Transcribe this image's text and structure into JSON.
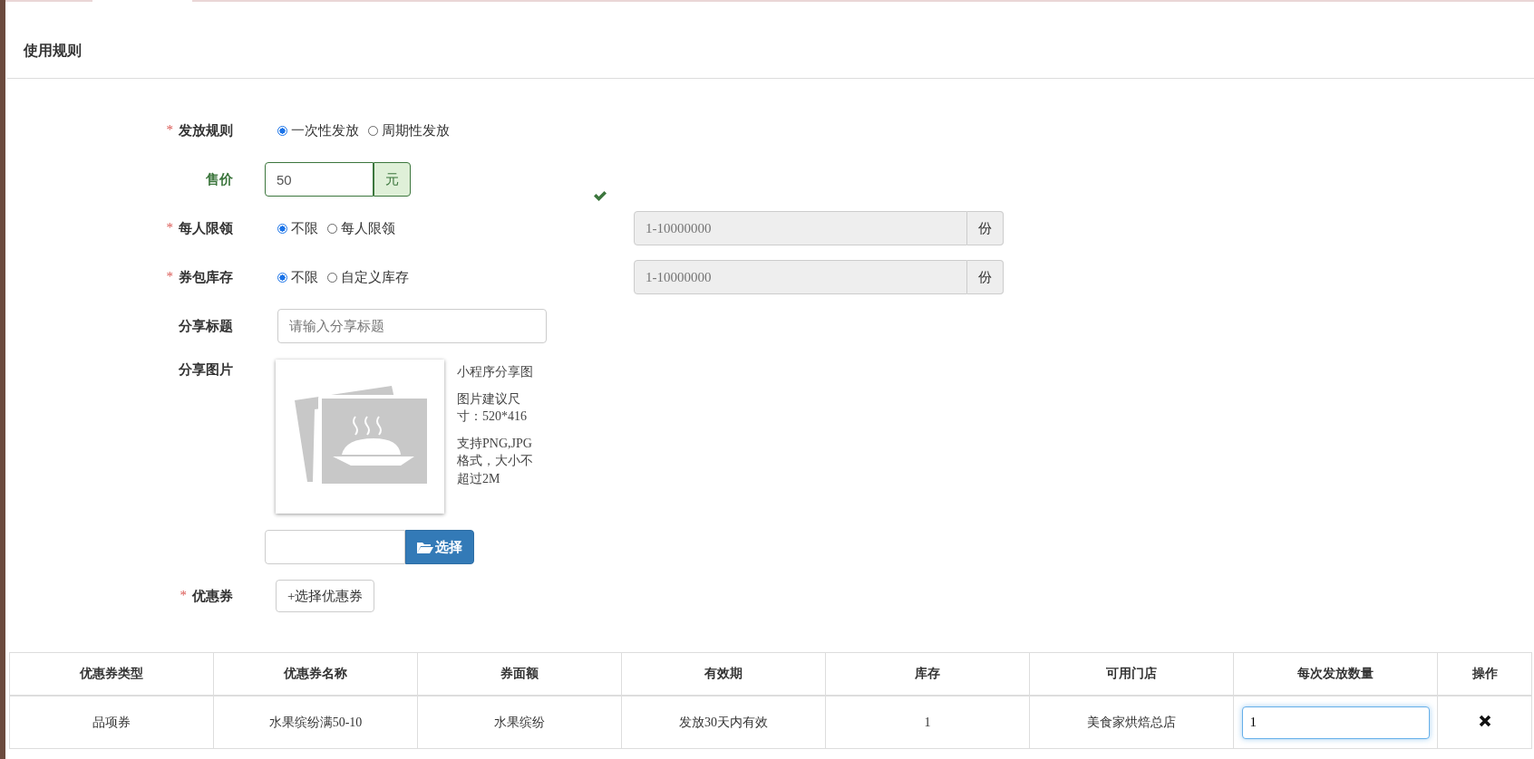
{
  "section": {
    "title": "使用规则"
  },
  "form": {
    "issue_rule": {
      "label": "发放规则",
      "required_mark": "*",
      "options": [
        {
          "label": "一次性发放",
          "selected": true
        },
        {
          "label": "周期性发放",
          "selected": false
        }
      ]
    },
    "price": {
      "label": "售价",
      "value": "50",
      "unit": "元",
      "valid": true
    },
    "per_person_limit": {
      "label": "每人限领",
      "required_mark": "*",
      "options": [
        {
          "label": "不限",
          "selected": true
        },
        {
          "label": "每人限领",
          "selected": false
        }
      ],
      "limit_field": {
        "placeholder": "1-10000000",
        "unit": "份",
        "disabled": true
      }
    },
    "package_stock": {
      "label": "券包库存",
      "required_mark": "*",
      "options": [
        {
          "label": "不限",
          "selected": true
        },
        {
          "label": "自定义库存",
          "selected": false
        }
      ],
      "limit_field": {
        "placeholder": "1-10000000",
        "unit": "份",
        "disabled": true
      }
    },
    "share_title": {
      "label": "分享标题",
      "placeholder": "请输入分享标题"
    },
    "share_image": {
      "label": "分享图片",
      "hints": [
        "小程序分享图",
        "图片建议尺寸：520*416",
        "支持PNG,JPG格式，大小不超过2M"
      ],
      "choose_button": "选择"
    },
    "coupons": {
      "label": "优惠券",
      "required_mark": "*",
      "button": "+选择优惠券"
    }
  },
  "table": {
    "columns": [
      "优惠券类型",
      "优惠券名称",
      "券面额",
      "有效期",
      "库存",
      "可用门店",
      "每次发放数量",
      "操作"
    ],
    "rows": [
      {
        "cells": [
          "品项券",
          "水果缤纷满50-10",
          "水果缤纷",
          "发放30天内有效",
          "1",
          "美食家烘焙总店"
        ],
        "quantity": "1",
        "quantity_focused": true
      }
    ]
  }
}
